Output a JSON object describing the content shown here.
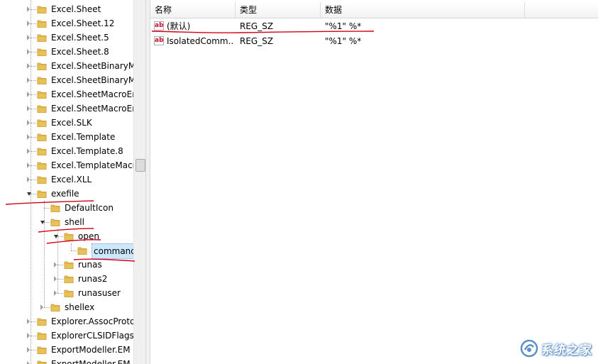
{
  "tree": {
    "items": [
      {
        "label": "Excel.Sheet",
        "level": 1,
        "expander": "collapsed"
      },
      {
        "label": "Excel.Sheet.12",
        "level": 1,
        "expander": "collapsed"
      },
      {
        "label": "Excel.Sheet.5",
        "level": 1,
        "expander": "collapsed"
      },
      {
        "label": "Excel.Sheet.8",
        "level": 1,
        "expander": "collapsed"
      },
      {
        "label": "Excel.SheetBinaryMa",
        "level": 1,
        "expander": "collapsed"
      },
      {
        "label": "Excel.SheetBinaryMa",
        "level": 1,
        "expander": "collapsed"
      },
      {
        "label": "Excel.SheetMacroEr",
        "level": 1,
        "expander": "collapsed"
      },
      {
        "label": "Excel.SheetMacroEr",
        "level": 1,
        "expander": "collapsed"
      },
      {
        "label": "Excel.SLK",
        "level": 1,
        "expander": "collapsed"
      },
      {
        "label": "Excel.Template",
        "level": 1,
        "expander": "collapsed"
      },
      {
        "label": "Excel.Template.8",
        "level": 1,
        "expander": "collapsed"
      },
      {
        "label": "Excel.TemplateMacr",
        "level": 1,
        "expander": "collapsed"
      },
      {
        "label": "Excel.XLL",
        "level": 1,
        "expander": "collapsed"
      },
      {
        "label": "exefile",
        "level": 1,
        "expander": "expanded"
      },
      {
        "label": "DefaultIcon",
        "level": 2,
        "expander": "none"
      },
      {
        "label": "shell",
        "level": 2,
        "expander": "expanded"
      },
      {
        "label": "open",
        "level": 3,
        "expander": "expanded"
      },
      {
        "label": "command",
        "level": 4,
        "expander": "none",
        "selected": true
      },
      {
        "label": "runas",
        "level": 3,
        "expander": "collapsed"
      },
      {
        "label": "runas2",
        "level": 3,
        "expander": "collapsed"
      },
      {
        "label": "runasuser",
        "level": 3,
        "expander": "collapsed"
      },
      {
        "label": "shellex",
        "level": 2,
        "expander": "collapsed"
      },
      {
        "label": "Explorer.AssocProto",
        "level": 1,
        "expander": "collapsed"
      },
      {
        "label": "ExplorerCLSIDFlags",
        "level": 1,
        "expander": "collapsed"
      },
      {
        "label": "ExportModeller.EM",
        "level": 1,
        "expander": "collapsed"
      },
      {
        "label": "ExportModeller.EM",
        "level": 1,
        "expander": "collapsed"
      }
    ]
  },
  "list": {
    "headers": {
      "name": "名称",
      "type": "类型",
      "data": "数据"
    },
    "rows": [
      {
        "name": "(默认)",
        "type": "REG_SZ",
        "data": "\"%1\" %*",
        "icon": "ab"
      },
      {
        "name": "IsolatedComm...",
        "type": "REG_SZ",
        "data": "\"%1\" %*",
        "icon": "ab"
      }
    ]
  },
  "watermark": {
    "text": "系统之家"
  },
  "colors": {
    "annotation": "#d4001a",
    "folder": "#e8c15a",
    "folder_dark": "#c89a2a",
    "selection": "#cce8ff"
  },
  "icons": {
    "folder": "folder-icon",
    "string_value": "reg-string-value-icon",
    "logo": "watermark-logo-icon"
  }
}
